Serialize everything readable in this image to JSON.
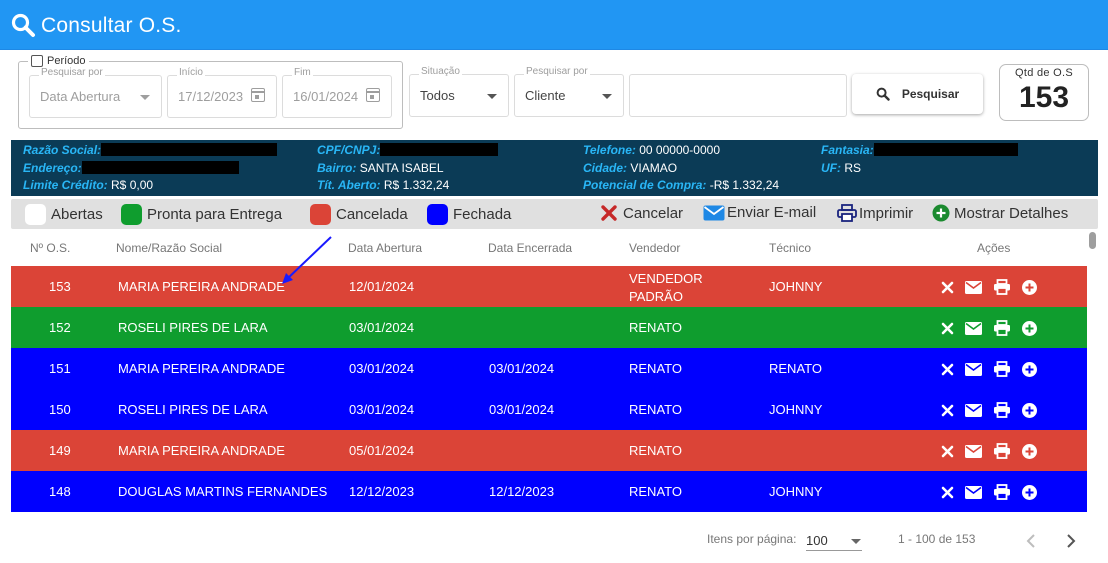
{
  "header": {
    "title": "Consultar O.S.",
    "icon": "search-icon"
  },
  "filters": {
    "periodo_label": "Período",
    "pesquisar_por_label": "Pesquisar por",
    "pesquisar_por_value": "Data Abertura",
    "inicio_label": "Início",
    "inicio_value": "17/12/2023",
    "fim_label": "Fim",
    "fim_value": "16/01/2024",
    "situacao_label": "Situação",
    "situacao_value": "Todos",
    "pesquisar_por2_label": "Pesquisar por",
    "pesquisar_por2_value": "Cliente",
    "search_value": "",
    "search_button": "Pesquisar"
  },
  "qtd": {
    "label": "Qtd de O.S",
    "value": "153"
  },
  "client": {
    "razao_label": "Razão Social:",
    "cpf_label": "CPF/CNPJ:",
    "telefone_label": "Telefone:",
    "telefone_value": "00 00000-0000",
    "fantasia_label": "Fantasia:",
    "endereco_label": "Endereço:",
    "bairro_label": "Bairro:",
    "bairro_value": "SANTA ISABEL",
    "cidade_label": "Cidade:",
    "cidade_value": "VIAMAO",
    "uf_label": "UF:",
    "uf_value": "RS",
    "limite_label": "Limite Crédito:",
    "limite_value": "R$ 0,00",
    "tit_label": "Tít. Aberto:",
    "tit_value": "R$ 1.332,24",
    "potencial_label": "Potencial de Compra:",
    "potencial_value": "-R$ 1.332,24"
  },
  "legend": {
    "abertas": "Abertas",
    "pronta": "Pronta para Entrega",
    "cancelada": "Cancelada",
    "fechada": "Fechada",
    "cancelar": "Cancelar",
    "enviar": "Enviar E-mail",
    "imprimir": "Imprimir",
    "detalhes": "Mostrar Detalhes"
  },
  "colors": {
    "header": "#2196f3",
    "info_bg": "#0b3b56",
    "cancelada": "#db4437",
    "pronta": "#0f9d2e",
    "fechada": "#0000ff",
    "abertas": "#ffffff"
  },
  "table": {
    "headers": [
      "Nº O.S.",
      "Nome/Razão Social",
      "Data Abertura",
      "Data Encerrada",
      "Vendedor",
      "Técnico",
      "Ações"
    ],
    "rows": [
      {
        "os": "153",
        "nome": "MARIA PEREIRA ANDRADE",
        "abertura": "12/01/2024",
        "encerrada": "",
        "vendedor": "VENDEDOR PADRÃO",
        "tecnico": "JOHNNY",
        "status": "cancelada"
      },
      {
        "os": "152",
        "nome": "ROSELI PIRES DE LARA",
        "abertura": "03/01/2024",
        "encerrada": "",
        "vendedor": "RENATO",
        "tecnico": "",
        "status": "pronta"
      },
      {
        "os": "151",
        "nome": "MARIA PEREIRA ANDRADE",
        "abertura": "03/01/2024",
        "encerrada": "03/01/2024",
        "vendedor": "RENATO",
        "tecnico": "RENATO",
        "status": "fechada"
      },
      {
        "os": "150",
        "nome": "ROSELI PIRES DE LARA",
        "abertura": "03/01/2024",
        "encerrada": "03/01/2024",
        "vendedor": "RENATO",
        "tecnico": "JOHNNY",
        "status": "fechada"
      },
      {
        "os": "149",
        "nome": "MARIA PEREIRA ANDRADE",
        "abertura": "05/01/2024",
        "encerrada": "",
        "vendedor": "RENATO",
        "tecnico": "",
        "status": "cancelada"
      },
      {
        "os": "148",
        "nome": "DOUGLAS MARTINS FERNANDES",
        "abertura": "12/12/2023",
        "encerrada": "12/12/2023",
        "vendedor": "RENATO",
        "tecnico": "JOHNNY",
        "status": "fechada"
      }
    ]
  },
  "pager": {
    "items_label": "Itens por página:",
    "page_size": "100",
    "range": "1 - 100 de 153"
  }
}
